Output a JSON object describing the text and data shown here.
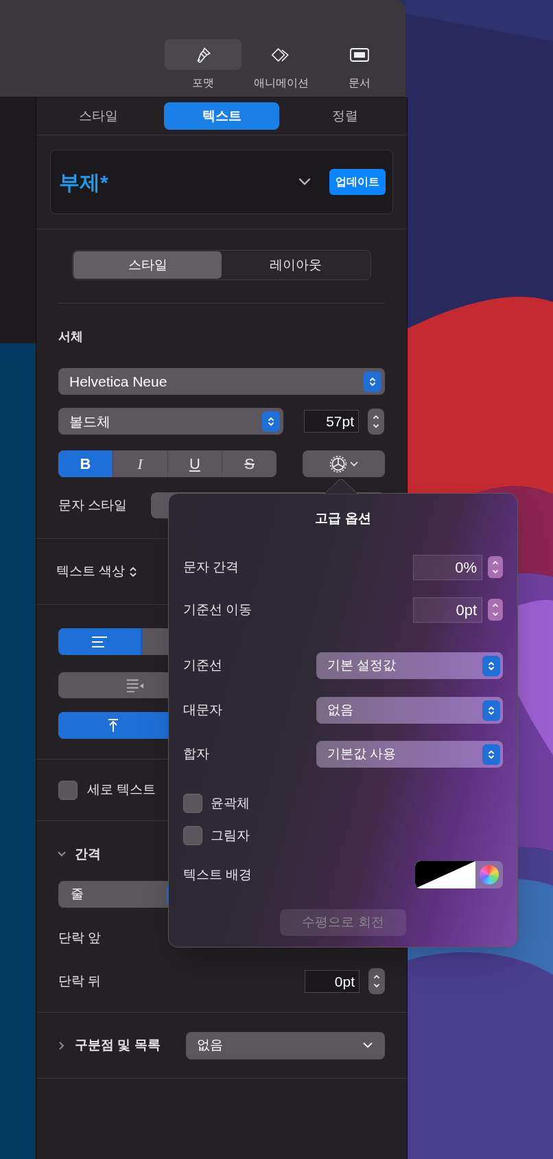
{
  "toolbar": {
    "buttons": [
      {
        "label": "포맷",
        "kind": "brush",
        "selected": true
      },
      {
        "label": "애니메이션",
        "kind": "diamonds",
        "selected": false
      },
      {
        "label": "문서",
        "kind": "document",
        "selected": false
      }
    ]
  },
  "tabs": [
    {
      "label": "스타일",
      "selected": false
    },
    {
      "label": "텍스트",
      "selected": true
    },
    {
      "label": "정렬",
      "selected": false
    }
  ],
  "paragraph_style": {
    "name": "부제*",
    "update_button": "업데이트"
  },
  "segments": [
    {
      "label": "스타일",
      "selected": true
    },
    {
      "label": "레이아웃",
      "selected": false
    }
  ],
  "font": {
    "heading": "서체",
    "family": "Helvetica Neue",
    "typeface": "볼드체",
    "size": "57pt",
    "character_style_label": "문자 스타일",
    "styles": [
      {
        "label": "B",
        "kind": "bold",
        "on": true
      },
      {
        "label": "I",
        "kind": "italic",
        "on": false
      },
      {
        "label": "U",
        "kind": "underline",
        "on": false
      },
      {
        "label": "S",
        "kind": "strike",
        "on": false
      }
    ]
  },
  "text_color": {
    "label": "텍스트 색상"
  },
  "horizontal_alignment": [
    {
      "kind": "left",
      "selected": true
    }
  ],
  "vertical_alignment": [
    {
      "kind": "top",
      "selected": true
    }
  ],
  "vertical_text": {
    "label": "세로 텍스트",
    "checked": false
  },
  "spacing": {
    "label": "간격",
    "expanded": true,
    "line_spacing": "줄",
    "before_label": "단락 앞",
    "after_label": "단락 뒤",
    "after_value": "0pt"
  },
  "bullets": {
    "label": "구분점 및 목록",
    "expanded": false,
    "value": "없음"
  },
  "advanced_options": {
    "title": "고급 옵션",
    "fields": [
      {
        "label": "문자 간격",
        "value": "0%"
      },
      {
        "label": "기준선 이동",
        "value": "0pt"
      }
    ],
    "popups": [
      {
        "label": "기준선",
        "value": "기본 설정값"
      },
      {
        "label": "대문자",
        "value": "없음"
      },
      {
        "label": "합자",
        "value": "기본값 사용"
      }
    ],
    "checkboxes": [
      {
        "label": "윤곽체",
        "checked": false
      },
      {
        "label": "그림자",
        "checked": false
      }
    ],
    "text_background_label": "텍스트 배경",
    "rotate_button": {
      "label": "수평으로 회전",
      "disabled": true
    }
  }
}
